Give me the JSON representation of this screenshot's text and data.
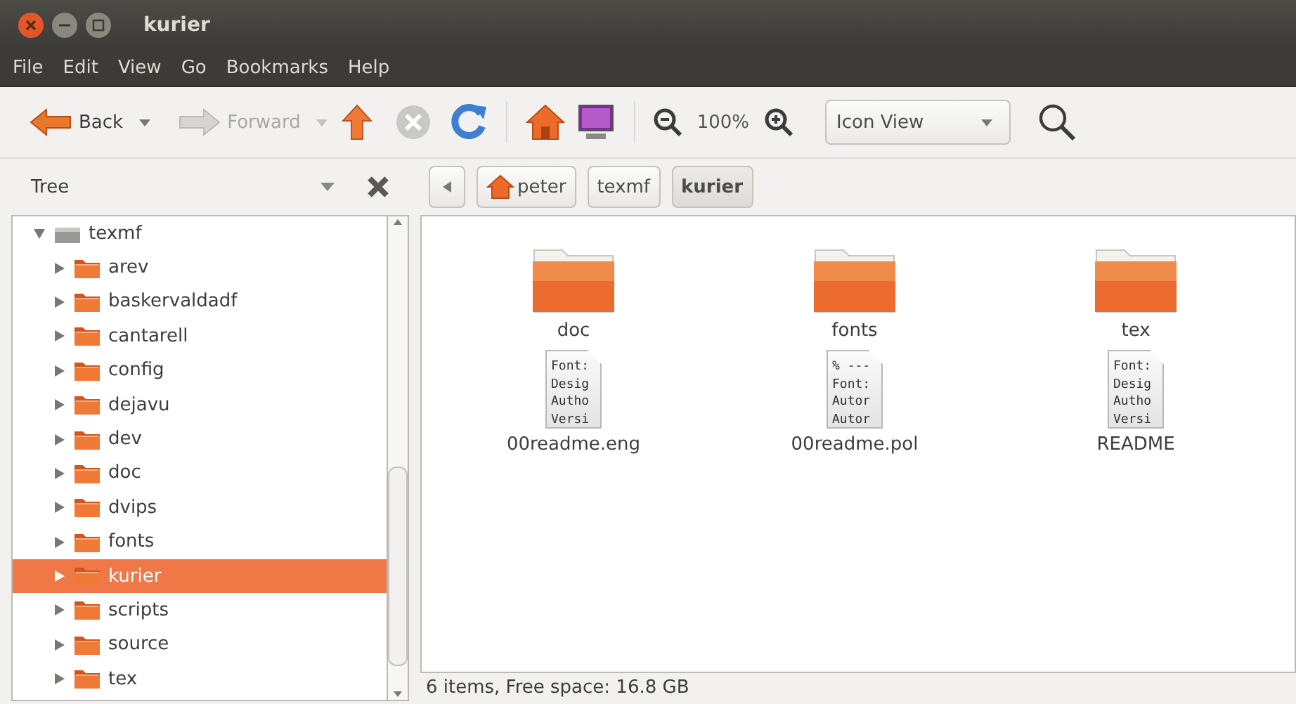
{
  "window": {
    "title": "kurier"
  },
  "menu": [
    "File",
    "Edit",
    "View",
    "Go",
    "Bookmarks",
    "Help"
  ],
  "toolbar": {
    "back": {
      "label": "Back",
      "disabled": false
    },
    "forward": {
      "label": "Forward",
      "disabled": true
    },
    "stop": {
      "disabled": true
    },
    "zoom": "100%",
    "view_mode": "Icon View"
  },
  "sidebar": {
    "title": "Tree",
    "tree": [
      {
        "label": "texmf",
        "kind": "drive",
        "expanded": true,
        "selected": false,
        "children": [
          {
            "label": "arev",
            "kind": "folder",
            "expanded": false,
            "selected": false
          },
          {
            "label": "baskervaldadf",
            "kind": "folder",
            "expanded": false,
            "selected": false
          },
          {
            "label": "cantarell",
            "kind": "folder",
            "expanded": false,
            "selected": false
          },
          {
            "label": "config",
            "kind": "folder",
            "expanded": false,
            "selected": false
          },
          {
            "label": "dejavu",
            "kind": "folder",
            "expanded": false,
            "selected": false
          },
          {
            "label": "dev",
            "kind": "folder",
            "expanded": false,
            "selected": false
          },
          {
            "label": "doc",
            "kind": "folder",
            "expanded": false,
            "selected": false
          },
          {
            "label": "dvips",
            "kind": "folder",
            "expanded": false,
            "selected": false
          },
          {
            "label": "fonts",
            "kind": "folder",
            "expanded": false,
            "selected": false
          },
          {
            "label": "kurier",
            "kind": "folder",
            "expanded": false,
            "selected": true
          },
          {
            "label": "scripts",
            "kind": "folder",
            "expanded": false,
            "selected": false
          },
          {
            "label": "source",
            "kind": "folder",
            "expanded": false,
            "selected": false
          },
          {
            "label": "tex",
            "kind": "folder",
            "expanded": false,
            "selected": false
          }
        ]
      }
    ]
  },
  "path_bar": [
    {
      "label": "peter",
      "kind": "home",
      "selected": false
    },
    {
      "label": "texmf",
      "kind": "folder",
      "selected": false
    },
    {
      "label": "kurier",
      "kind": "folder",
      "selected": true
    }
  ],
  "files": [
    {
      "name": "doc",
      "kind": "folder"
    },
    {
      "name": "fonts",
      "kind": "folder"
    },
    {
      "name": "tex",
      "kind": "folder"
    },
    {
      "name": "00readme.eng",
      "kind": "text",
      "preview_lines": [
        "Font:",
        "Desig",
        "Autho",
        "Versi"
      ]
    },
    {
      "name": "00readme.pol",
      "kind": "text",
      "preview_lines": [
        "% ---",
        "Font:",
        "Autor",
        "Autor"
      ]
    },
    {
      "name": "README",
      "kind": "text",
      "preview_lines": [
        "Font:",
        "Desig",
        "Autho",
        "Versi"
      ]
    }
  ],
  "status_bar": "6 items, Free space: 16.8 GB"
}
